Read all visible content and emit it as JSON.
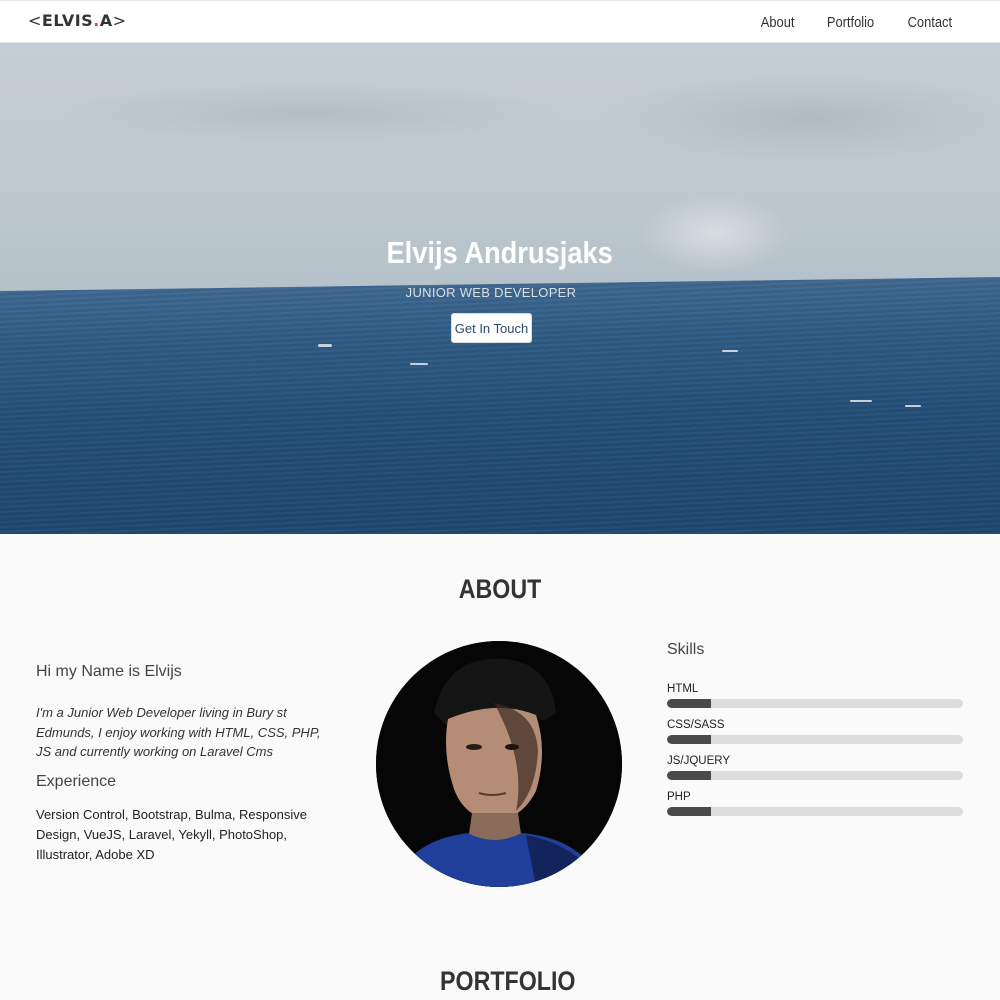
{
  "navbar": {
    "logo": {
      "open": "<",
      "text": "ELVIS",
      "dot": ".",
      "suffix": "A",
      "close": ">"
    },
    "links": [
      {
        "label": "About"
      },
      {
        "label": "Portfolio"
      },
      {
        "label": "Contact"
      }
    ]
  },
  "hero": {
    "name": "Elvijs Andrusjaks",
    "subtitle": "JUNIOR WEB DEVELOPER",
    "cta_label": "Get In Touch"
  },
  "about": {
    "title": "ABOUT",
    "greeting": "Hi my Name is Elvijs",
    "intro": "I'm a Junior Web Developer living in Bury st Edmunds, I enjoy working with HTML, CSS, PHP, JS and currently working on Laravel Cms",
    "experience_heading": "Experience",
    "experience_text": "Version Control, Bootstrap, Bulma, Responsive Design, VueJS, Laravel, Yekyll, PhotoShop, Illustrator, Adobe XD",
    "skills_heading": "Skills",
    "skills": [
      {
        "name": "HTML",
        "level": 0.15
      },
      {
        "name": "CSS/SASS",
        "level": 0.15
      },
      {
        "name": "JS/JQUERY",
        "level": 0.15
      },
      {
        "name": "PHP",
        "level": 0.15
      }
    ]
  },
  "portfolio": {
    "title": "PORTFOLIO"
  },
  "colors": {
    "nav_bg": "#ffffff",
    "page_bg": "#fafafa",
    "skill_fill": "#4a4a4a",
    "skill_track": "#dcdcdc",
    "logo_dot": "#e74c3c"
  }
}
